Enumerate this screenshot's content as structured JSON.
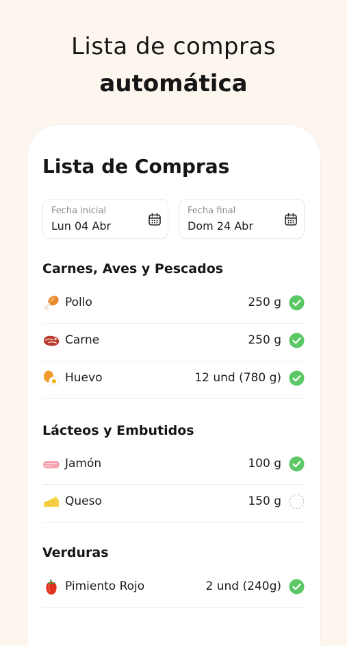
{
  "hero": {
    "line1": "Lista de compras",
    "line2": "automática"
  },
  "screen": {
    "title": "Lista de Compras",
    "date_start": {
      "label": "Fecha inicial",
      "value": "Lun 04 Abr"
    },
    "date_end": {
      "label": "Fecha final",
      "value": "Dom 24 Abr"
    }
  },
  "sections": [
    {
      "title": "Carnes, Aves y Pescados",
      "items": [
        {
          "name": "Pollo",
          "qty": "250 g",
          "icon": "chicken-leg-icon",
          "checked": true
        },
        {
          "name": "Carne",
          "qty": "250 g",
          "icon": "meat-icon",
          "checked": true
        },
        {
          "name": "Huevo",
          "qty": "12 und (780 g)",
          "icon": "egg-icon",
          "checked": true
        }
      ]
    },
    {
      "title": "Lácteos y Embutidos",
      "items": [
        {
          "name": "Jamón",
          "qty": "100 g",
          "icon": "ham-icon",
          "checked": true
        },
        {
          "name": "Queso",
          "qty": "150 g",
          "icon": "cheese-icon",
          "checked": false
        }
      ]
    },
    {
      "title": "Verduras",
      "items": [
        {
          "name": "Pimiento Rojo",
          "qty": "2 und (240g)",
          "icon": "red-pepper-icon",
          "checked": true
        }
      ]
    }
  ],
  "colors": {
    "background": "#fcf6ee",
    "check_green": "#5cc765",
    "card": "#ffffff"
  }
}
